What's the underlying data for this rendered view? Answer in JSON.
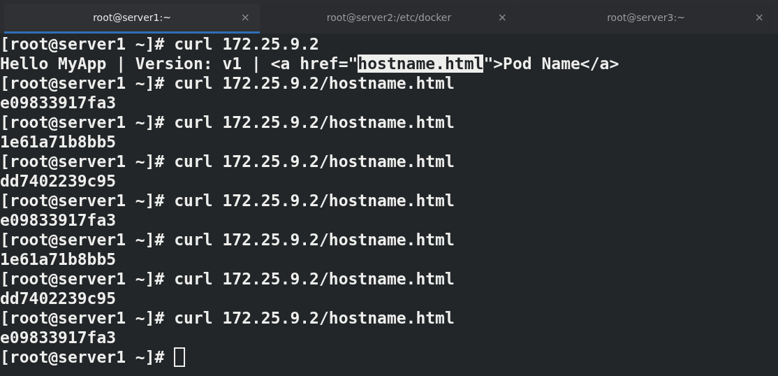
{
  "tabs": [
    {
      "title": "root@server1:~",
      "close": "×",
      "selected": true
    },
    {
      "title": "root@server2:/etc/docker",
      "close": "×",
      "selected": false
    },
    {
      "title": "root@server3:~",
      "close": "×",
      "selected": false
    }
  ],
  "terminal": {
    "lines": [
      {
        "segments": [
          {
            "text": "[root@server1 ~]# curl 172.25.9.2",
            "selected": false
          }
        ]
      },
      {
        "segments": [
          {
            "text": "Hello MyApp | Version: v1 | <a href=\"",
            "selected": false
          },
          {
            "text": "hostname.html",
            "selected": true
          },
          {
            "text": "\">Pod Name</a>",
            "selected": false
          }
        ]
      },
      {
        "segments": [
          {
            "text": "[root@server1 ~]# curl 172.25.9.2/hostname.html",
            "selected": false
          }
        ]
      },
      {
        "segments": [
          {
            "text": "e09833917fa3",
            "selected": false
          }
        ]
      },
      {
        "segments": [
          {
            "text": "[root@server1 ~]# curl 172.25.9.2/hostname.html",
            "selected": false
          }
        ]
      },
      {
        "segments": [
          {
            "text": "1e61a71b8bb5",
            "selected": false
          }
        ]
      },
      {
        "segments": [
          {
            "text": "[root@server1 ~]# curl 172.25.9.2/hostname.html",
            "selected": false
          }
        ]
      },
      {
        "segments": [
          {
            "text": "dd7402239c95",
            "selected": false
          }
        ]
      },
      {
        "segments": [
          {
            "text": "[root@server1 ~]# curl 172.25.9.2/hostname.html",
            "selected": false
          }
        ]
      },
      {
        "segments": [
          {
            "text": "e09833917fa3",
            "selected": false
          }
        ]
      },
      {
        "segments": [
          {
            "text": "[root@server1 ~]# curl 172.25.9.2/hostname.html",
            "selected": false
          }
        ]
      },
      {
        "segments": [
          {
            "text": "1e61a71b8bb5",
            "selected": false
          }
        ]
      },
      {
        "segments": [
          {
            "text": "[root@server1 ~]# curl 172.25.9.2/hostname.html",
            "selected": false
          }
        ]
      },
      {
        "segments": [
          {
            "text": "dd7402239c95",
            "selected": false
          }
        ]
      },
      {
        "segments": [
          {
            "text": "[root@server1 ~]# curl 172.25.9.2/hostname.html",
            "selected": false
          }
        ]
      },
      {
        "segments": [
          {
            "text": "e09833917fa3",
            "selected": false
          }
        ]
      }
    ],
    "prompt": "[root@server1 ~]#",
    "cursor": true
  }
}
